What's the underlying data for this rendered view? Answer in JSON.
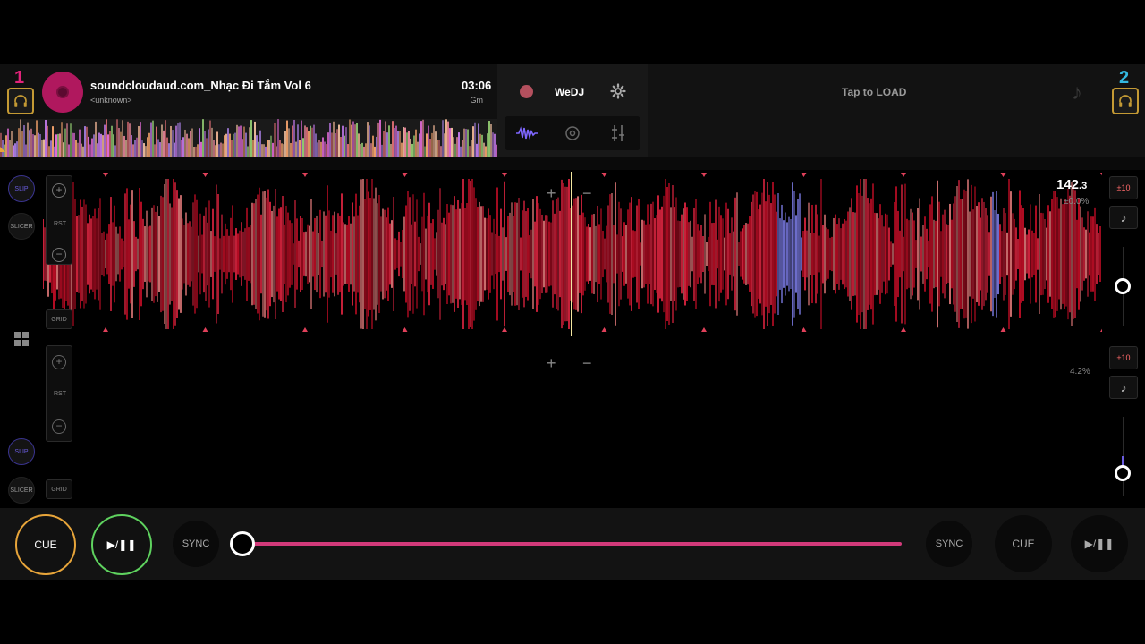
{
  "deck1": {
    "number": "1",
    "title": "soundcloudaud.com_Nhạc Đi Tắm Vol 6",
    "artist": "<unknown>",
    "time": "03:06",
    "key": "Gm",
    "bpm_int": "142",
    "bpm_dec": ".3",
    "pitch": "±0.0%",
    "range_label": "±10",
    "slip_label": "SLIP",
    "slicer_label": "SLICER",
    "rst_label": "RST",
    "grid_label": "GRID",
    "colors": {
      "accent": "#e2237a",
      "headphone": "#c49a34"
    }
  },
  "deck2": {
    "number": "2",
    "tap_to_load": "Tap to LOAD",
    "pitch": "4.2%",
    "range_label": "±10",
    "slip_label": "SLIP",
    "slicer_label": "SLICER",
    "rst_label": "RST",
    "grid_label": "GRID",
    "colors": {
      "accent": "#34b8e0"
    }
  },
  "center": {
    "brand": "WeDJ",
    "icons": [
      "record-icon",
      "settings-icon",
      "waveform-mode-icon",
      "jog-mode-icon",
      "mixer-mode-icon"
    ]
  },
  "transport": {
    "cue_label": "CUE",
    "play_label": "▶/❚❚",
    "sync_label": "SYNC",
    "cue2_label": "CUE",
    "play2_label": "▶/❚❚",
    "sync2_label": "SYNC"
  },
  "crossfader": {
    "position": 0.0,
    "color": "#d23a7a"
  }
}
